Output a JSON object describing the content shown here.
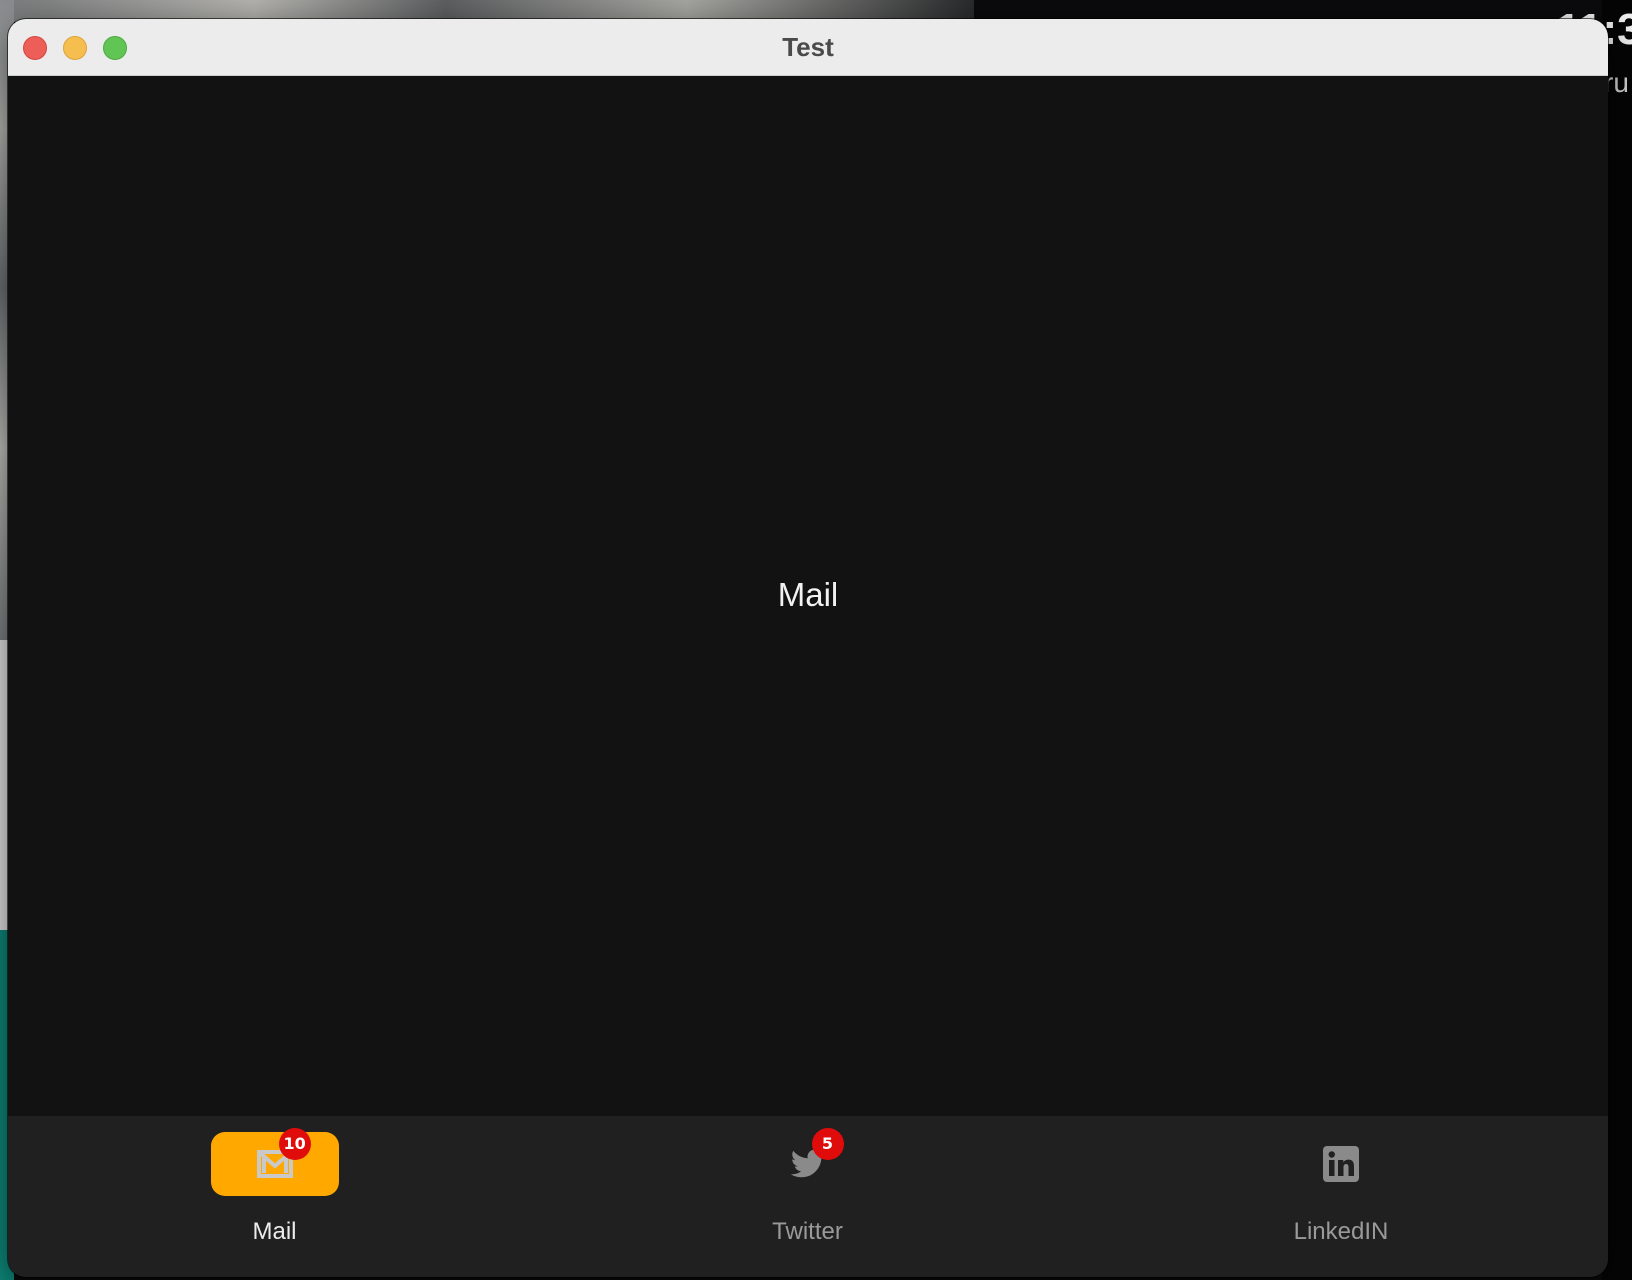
{
  "window": {
    "title": "Test"
  },
  "desktop": {
    "clock_fragment": "11:3",
    "date_fragment": "ru"
  },
  "content": {
    "label": "Mail"
  },
  "tabs": [
    {
      "label": "Mail",
      "icon": "mail-icon",
      "badge": "10",
      "active": true
    },
    {
      "label": "Twitter",
      "icon": "twitter-bird-icon",
      "badge": "5",
      "active": false
    },
    {
      "label": "LinkedIN",
      "icon": "linkedin-icon",
      "badge": "",
      "active": false
    }
  ],
  "colors": {
    "accent": "#ffa800",
    "badge": "#e00b0b",
    "content_bg": "#121212",
    "tabbar_bg": "#202020"
  }
}
